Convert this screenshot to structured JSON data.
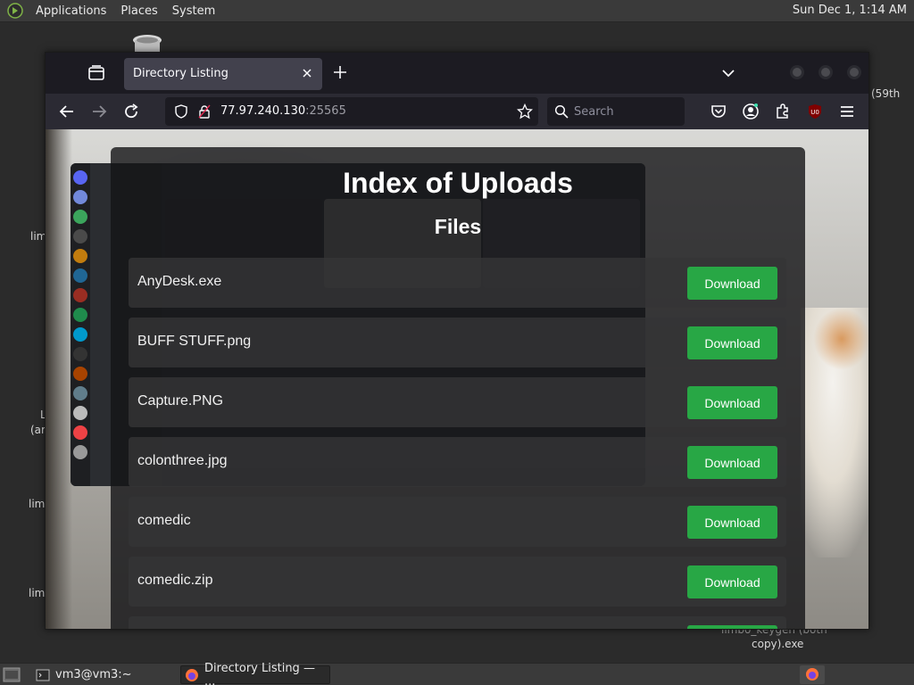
{
  "top_panel": {
    "menus": [
      "Applications",
      "Places",
      "System"
    ],
    "clock": "Sun Dec 1, 1:14 AM"
  },
  "desktop": {
    "icon_labels": {
      "right_top": "(59th",
      "left_1": "lim",
      "left_2a": "L",
      "left_2b": "(ar",
      "left_3": "lim",
      "left_4": "lim",
      "bottom_right_1": "limbo_keygen (both",
      "bottom_right_2": "copy).exe"
    }
  },
  "browser": {
    "tab_title": "Directory Listing",
    "url_host": "77.97.240.130",
    "url_port": ":25565",
    "search_placeholder": "Search",
    "extension_badge": "U0"
  },
  "page": {
    "title": "Index of Uploads",
    "section_title": "Files",
    "download_label": "Download",
    "files": [
      "AnyDesk.exe",
      "BUFF STUFF.png",
      "Capture.PNG",
      "colonthree.jpg",
      "comedic",
      "comedic.zip"
    ]
  },
  "bottom_panel": {
    "tasks": [
      "vm3@vm3:~",
      "Directory Listing — ..."
    ]
  },
  "colors": {
    "download_button": "#28a745",
    "tab_active": "#42414d",
    "toolbar": "#2b2a33",
    "urlbar": "#1c1b22"
  }
}
